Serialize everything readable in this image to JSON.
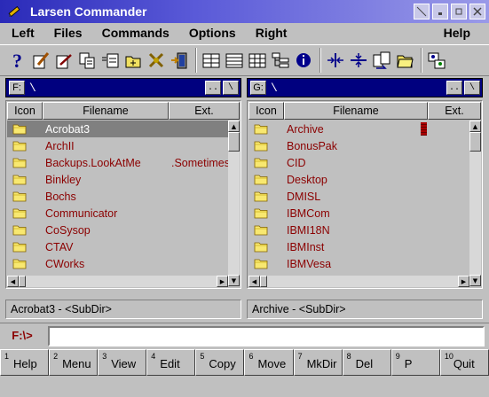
{
  "window": {
    "title": "Larsen Commander"
  },
  "menu": [
    "Left",
    "Files",
    "Commands",
    "Options",
    "Right"
  ],
  "menu_help": "Help",
  "toolbar": {
    "icons": [
      "help-icon",
      "edit-icon",
      "view-icon",
      "copy-icon",
      "move-icon",
      "mkdir-icon",
      "delete-icon",
      "exit-icon",
      "brief-view-icon",
      "full-view-icon",
      "detail-view-icon",
      "tree-view-icon",
      "info-icon",
      "swap-panels-icon",
      "equal-panels-icon",
      "compare-icon",
      "folder-icon",
      "settings-icon"
    ]
  },
  "columns": {
    "icon": "Icon",
    "filename": "Filename",
    "ext": "Ext."
  },
  "left_panel": {
    "drive": "F:",
    "path": "\\",
    "dotdot": "..",
    "root": "\\",
    "files": [
      {
        "name": "Acrobat3",
        "ext": ""
      },
      {
        "name": "ArchII",
        "ext": ""
      },
      {
        "name": "Backups.LookAtMe",
        "ext": ".Sometimes"
      },
      {
        "name": "Binkley",
        "ext": ""
      },
      {
        "name": "Bochs",
        "ext": ""
      },
      {
        "name": "Communicator",
        "ext": ""
      },
      {
        "name": "CoSysop",
        "ext": ""
      },
      {
        "name": "CTAV",
        "ext": ""
      },
      {
        "name": "CWorks",
        "ext": ""
      }
    ],
    "status": "Acrobat3 - <SubDir>"
  },
  "right_panel": {
    "drive": "G:",
    "path": "\\",
    "dotdot": "..",
    "root": "\\",
    "files": [
      {
        "name": "Archive",
        "ext": ""
      },
      {
        "name": "BonusPak",
        "ext": ""
      },
      {
        "name": "CID",
        "ext": ""
      },
      {
        "name": "Desktop",
        "ext": ""
      },
      {
        "name": "DMISL",
        "ext": ""
      },
      {
        "name": "IBMCom",
        "ext": ""
      },
      {
        "name": "IBMI18N",
        "ext": ""
      },
      {
        "name": "IBMInst",
        "ext": ""
      },
      {
        "name": "IBMVesa",
        "ext": ""
      }
    ],
    "status": "Archive - <SubDir>"
  },
  "command": {
    "prompt": "F:\\>",
    "value": ""
  },
  "fkeys": [
    {
      "num": "1",
      "label": "Help"
    },
    {
      "num": "2",
      "label": "Menu"
    },
    {
      "num": "3",
      "label": "View"
    },
    {
      "num": "4",
      "label": "Edit"
    },
    {
      "num": "5",
      "label": "Copy"
    },
    {
      "num": "6",
      "label": "Move"
    },
    {
      "num": "7",
      "label": "MkDir"
    },
    {
      "num": "8",
      "label": "Del"
    },
    {
      "num": "9",
      "label": "P"
    },
    {
      "num": "10",
      "label": "Quit"
    }
  ]
}
